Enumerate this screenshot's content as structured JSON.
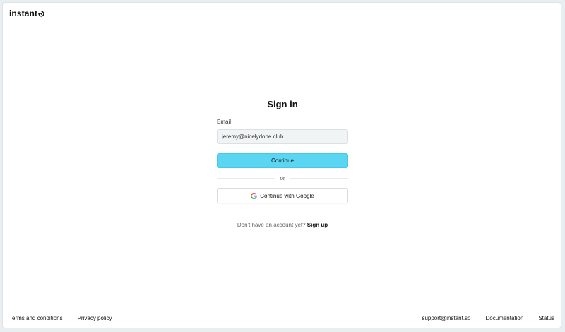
{
  "brand": {
    "name": "instant"
  },
  "signin": {
    "title": "Sign in",
    "email_label": "Email",
    "email_value": "jeremy@nicelydone.club",
    "continue_label": "Continue",
    "divider_text": "or",
    "google_label": "Continue with Google",
    "no_account_text": "Don't have an account yet?",
    "signup_label": "Sign up"
  },
  "footer": {
    "left": [
      "Terms and conditions",
      "Privacy policy"
    ],
    "right": [
      "support@instant.so",
      "Documentation",
      "Status"
    ]
  },
  "colors": {
    "accent": "#5bd6f2",
    "input_bg": "#f1f4f5"
  }
}
